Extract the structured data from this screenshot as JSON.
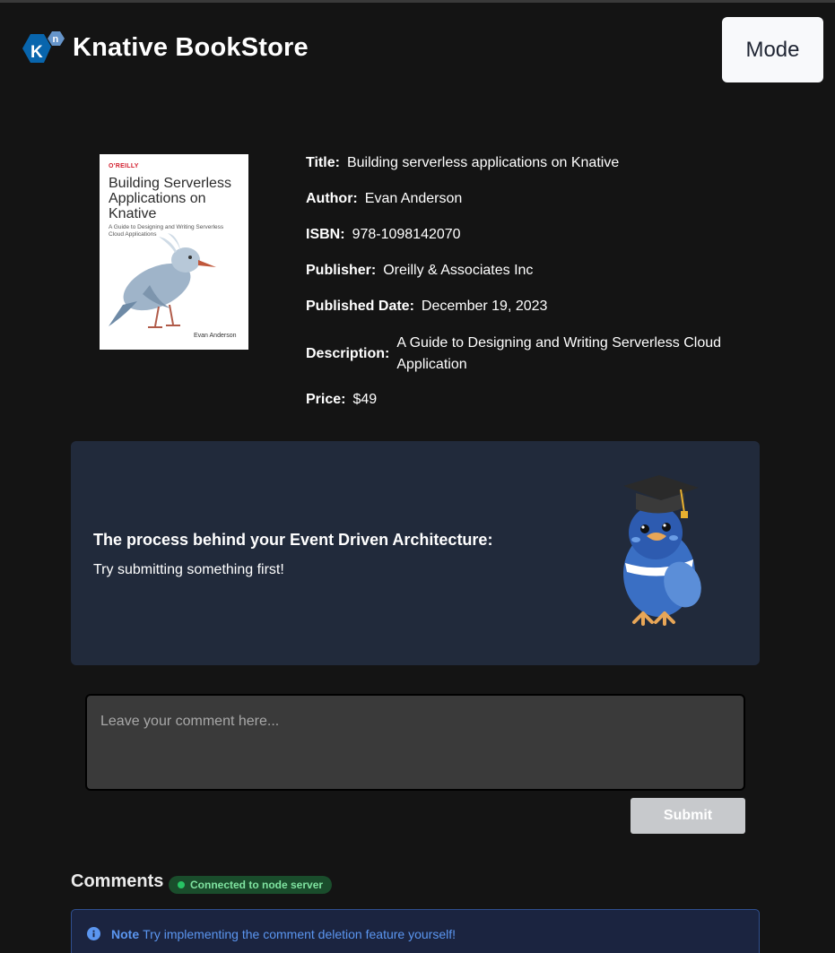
{
  "header": {
    "brand_title": "Knative BookStore",
    "mode_label": "Mode"
  },
  "book": {
    "cover": {
      "publisher": "O'REILLY",
      "title": "Building Serverless Applications on Knative",
      "subtitle": "A Guide to Designing and Writing Serverless Cloud Applications",
      "author": "Evan Anderson"
    },
    "details": [
      {
        "label": "Title:",
        "value": "Building serverless applications on Knative"
      },
      {
        "label": "Author:",
        "value": "Evan Anderson"
      },
      {
        "label": "ISBN:",
        "value": "978-1098142070"
      },
      {
        "label": "Publisher:",
        "value": "Oreilly & Associates Inc"
      },
      {
        "label": "Published Date:",
        "value": "December 19, 2023"
      },
      {
        "label": "Description:",
        "value": "A Guide to Designing and Writing Serverless Cloud Application"
      },
      {
        "label": "Price:",
        "value": "$49"
      }
    ]
  },
  "banner": {
    "heading": "The process behind your Event Driven Architecture:",
    "text": "Try submitting something first!"
  },
  "comment_form": {
    "placeholder": "Leave your comment here...",
    "submit_label": "Submit"
  },
  "comments": {
    "title": "Comments",
    "status_badge": "Connected to node server",
    "note_label": "Note",
    "note_text": "Try implementing the comment deletion feature yourself!"
  },
  "colors": {
    "background": "#141414",
    "banner_bg": "#212a3b",
    "status_green": "#27c464",
    "note_blue": "#5b96f0"
  }
}
